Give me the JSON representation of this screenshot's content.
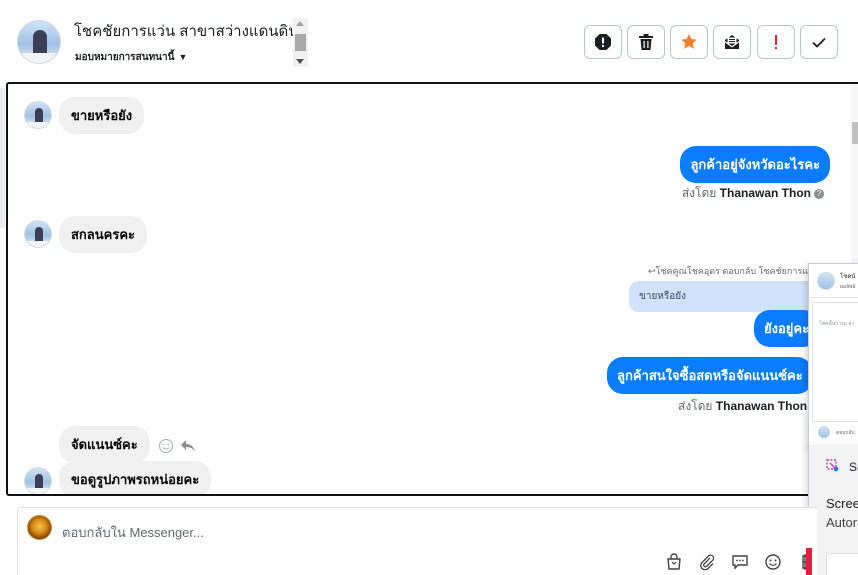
{
  "header": {
    "title": "โชคชัยการแว่น สาขาสว่างแดนดิน",
    "assign_label": "มอบหมายการสนทนานี้",
    "toolbar": {
      "spam": "spam-icon",
      "delete": "trash-icon",
      "star": "star-icon",
      "unread": "envelope-icon",
      "follow_up": "exclamation-icon",
      "done": "check-icon",
      "star_color": "#f5822a",
      "follow_up_color": "#e41e3f"
    }
  },
  "messages": [
    {
      "dir": "in",
      "text": "ขายหรือยัง"
    },
    {
      "dir": "out",
      "text": "ลูกค้าอยู่จังหวัดอะไรคะ",
      "sent_by_label": "ส่งโดย",
      "sent_by_name": "Thanawan Thon"
    },
    {
      "dir": "in",
      "text": "สกลนครคะ"
    },
    {
      "dir": "out",
      "reply_note": "โชคคูณโชคอุดร ตอบกลับ โชคชัยการแ",
      "quote": "ขายหรือยัง",
      "text": "ยังอยู่คะ"
    },
    {
      "dir": "out",
      "text": "ลูกค้าสนใจซื้อสดหรือจัดแนนซ์คะ",
      "sent_by_label": "ส่งโดย",
      "sent_by_name": "Thanawan Thon"
    },
    {
      "dir": "in",
      "text": "จัดแนนซ์คะ"
    },
    {
      "dir": "in",
      "text": "ขอดูรูปภาพรถหน่อยคะ"
    }
  ],
  "overlay": {
    "title": "โชคนั",
    "subtitle": "ผลลัพธ์",
    "note": "โชคนั้นการแ สา",
    "footer_text": "ตอบกลับ"
  },
  "snip": {
    "app_name": "Sn",
    "line1": "Scree",
    "line2": "Autor"
  },
  "composer": {
    "placeholder": "ตอบกลับใน Messenger...",
    "icons": [
      "bag-icon",
      "paperclip-icon",
      "chat-icon",
      "emoji-icon",
      "baht-icon"
    ]
  }
}
